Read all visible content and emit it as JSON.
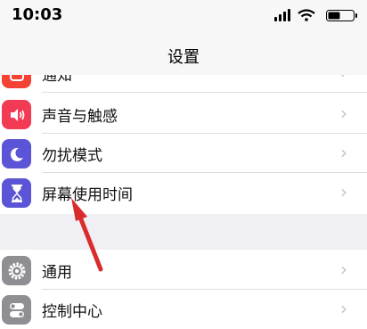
{
  "status": {
    "time": "10:03"
  },
  "nav": {
    "title": "设置"
  },
  "group1": [
    {
      "label": "通知",
      "icon": "notification-icon",
      "color": "#f44335"
    },
    {
      "label": "声音与触感",
      "icon": "speaker-icon",
      "color": "#f23a55"
    },
    {
      "label": "勿扰模式",
      "icon": "moon-icon",
      "color": "#5b54d6"
    },
    {
      "label": "屏幕使用时间",
      "icon": "hourglass-icon",
      "color": "#5b54d6"
    }
  ],
  "group2": [
    {
      "label": "通用",
      "icon": "gear-icon",
      "color": "#8e8e93"
    },
    {
      "label": "控制中心",
      "icon": "toggle-icon",
      "color": "#8e8e93"
    }
  ],
  "annotation": {
    "color": "#d92d2d"
  }
}
